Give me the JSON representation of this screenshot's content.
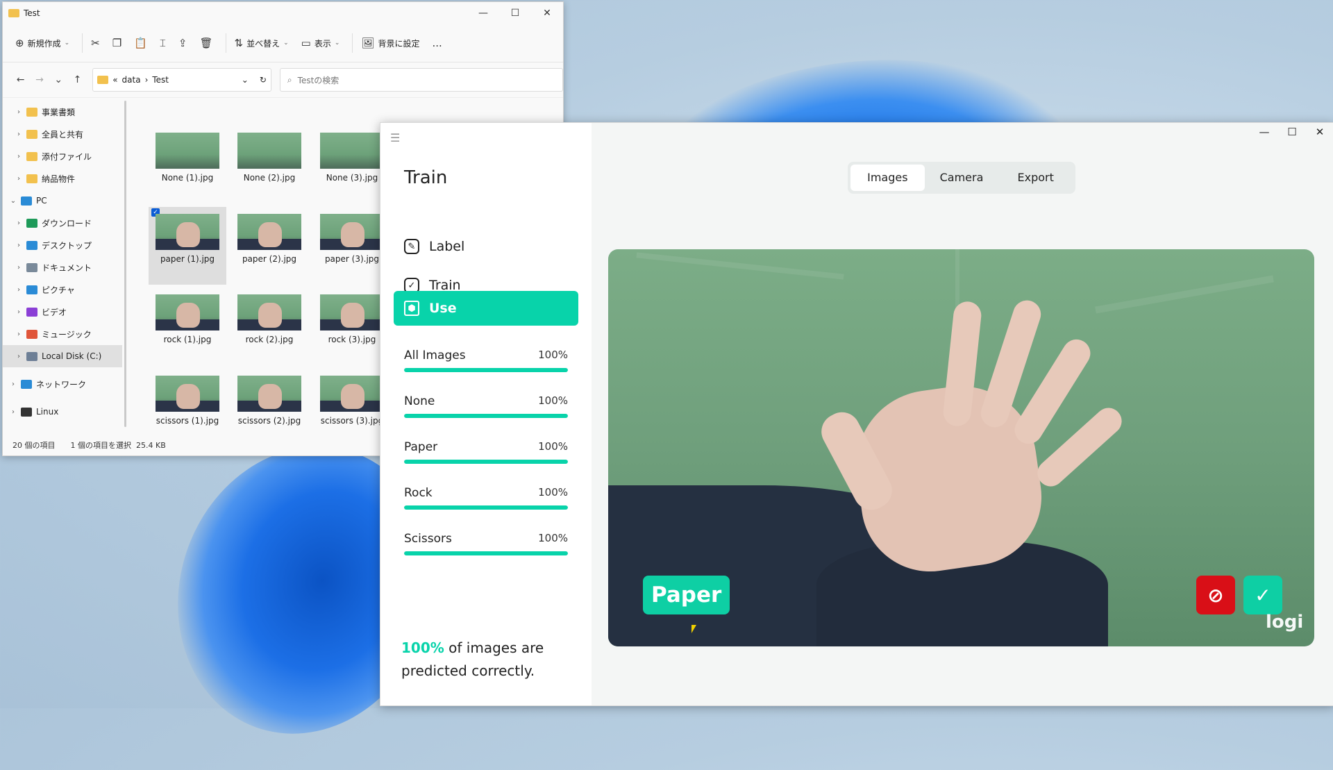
{
  "explorer": {
    "title": "Test",
    "toolbar": {
      "new": "新規作成",
      "sort": "並べ替え",
      "view": "表示",
      "set_background": "背景に設定",
      "more": "..."
    },
    "address": {
      "prefix": "«",
      "crumb1": "data",
      "sep": "›",
      "crumb2": "Test"
    },
    "search_placeholder": "Testの検索",
    "nav": [
      {
        "label": "事業書類",
        "color": "#f2c14e"
      },
      {
        "label": "全員と共有",
        "color": "#f2c14e"
      },
      {
        "label": "添付ファイル",
        "color": "#f2c14e"
      },
      {
        "label": "納品物件",
        "color": "#f2c14e"
      },
      {
        "label": "PC",
        "color": "#2a8bd6"
      },
      {
        "label": "ダウンロード",
        "color": "#1e9a59"
      },
      {
        "label": "デスクトップ",
        "color": "#2a8bd6"
      },
      {
        "label": "ドキュメント",
        "color": "#7a8a9a"
      },
      {
        "label": "ピクチャ",
        "color": "#2a8bd6"
      },
      {
        "label": "ビデオ",
        "color": "#8b3fd6"
      },
      {
        "label": "ミュージック",
        "color": "#e0553a"
      },
      {
        "label": "Local Disk (C:)",
        "color": "#6d7f96"
      },
      {
        "label": "ネットワーク",
        "color": "#2a8bd6"
      },
      {
        "label": "Linux",
        "color": "#333333"
      }
    ],
    "files": [
      [
        "None (1).jpg",
        "None (2).jpg",
        "None (3).jpg"
      ],
      [
        "paper (1).jpg",
        "paper (2).jpg",
        "paper (3).jpg"
      ],
      [
        "rock (1).jpg",
        "rock (2).jpg",
        "rock (3).jpg"
      ],
      [
        "scissors (1).jpg",
        "scissors (2).jpg",
        "scissors (3).jpg"
      ]
    ],
    "status": {
      "count": "20 個の項目",
      "selected": "1 個の項目を選択",
      "size": "25.4 KB"
    }
  },
  "app": {
    "title": "Train",
    "menu": [
      {
        "label": "Label",
        "icon": "pencil-icon"
      },
      {
        "label": "Train",
        "icon": "check-square-icon"
      },
      {
        "label": "Use",
        "icon": "cube-icon"
      }
    ],
    "stats": [
      {
        "label": "All Images",
        "pct": "100%",
        "value": 1.0
      },
      {
        "label": "None",
        "pct": "100%",
        "value": 1.0
      },
      {
        "label": "Paper",
        "pct": "100%",
        "value": 1.0
      },
      {
        "label": "Rock",
        "pct": "100%",
        "value": 1.0
      },
      {
        "label": "Scissors",
        "pct": "100%",
        "value": 1.0
      }
    ],
    "summary": {
      "pct": "100%",
      "text": "of images are predicted correctly."
    },
    "tabs": [
      "Images",
      "Camera",
      "Export"
    ],
    "prediction": "Paper",
    "logo": "logi",
    "accent": "#08d3aa"
  }
}
